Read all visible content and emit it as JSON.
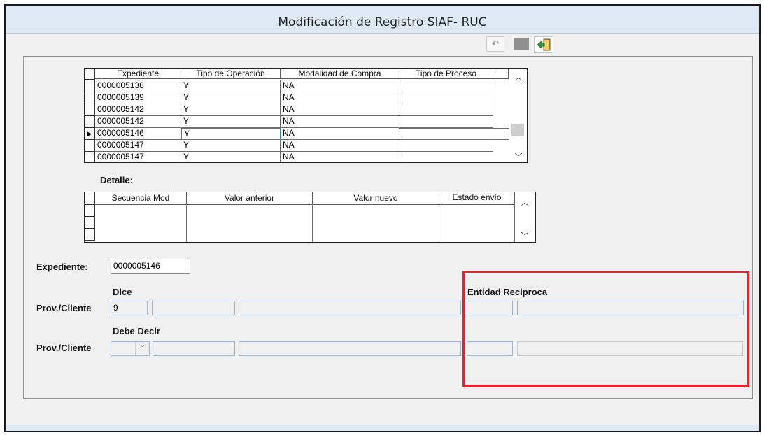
{
  "window": {
    "title": "Modificación de Registro SIAF- RUC"
  },
  "toolbar": [
    {
      "name": "undo-icon",
      "glyph": "↶"
    },
    {
      "name": "stop-icon",
      "glyph": ""
    },
    {
      "name": "exit-icon",
      "glyph": ""
    }
  ],
  "grid_main": {
    "columns": [
      "Expediente",
      "Tipo de Operación",
      "Modalidad de Compra",
      "Tipo de Proceso"
    ],
    "rows": [
      [
        "0000005138",
        "Y",
        "NA",
        ""
      ],
      [
        "0000005139",
        "Y",
        "NA",
        ""
      ],
      [
        "0000005142",
        "Y",
        "NA",
        ""
      ],
      [
        "0000005142",
        "Y",
        "NA",
        ""
      ],
      [
        "0000005146",
        "Y",
        "NA",
        ""
      ],
      [
        "0000005147",
        "Y",
        "NA",
        ""
      ],
      [
        "0000005147",
        "Y",
        "NA",
        ""
      ]
    ],
    "selected_row": 4,
    "row_indicator": "▶"
  },
  "detalle": {
    "label": "Detalle:",
    "columns": [
      "Secuencia Mod",
      "Valor anterior",
      "Valor nuevo",
      "Estado envío"
    ]
  },
  "form": {
    "expediente_label": "Expediente:",
    "expediente_value": "0000005146",
    "dice_label": "Dice",
    "entidad_label": "Entidad Reciproca",
    "prov_label_1": "Prov./Cliente",
    "prov_value_1": "9",
    "debe_decir_label": "Debe Decir",
    "prov_label_2": "Prov./Cliente"
  },
  "colors": {
    "highlight": "#e0242d",
    "titlebar": "#dfe8f5",
    "field_border": "#9fb3cc"
  }
}
